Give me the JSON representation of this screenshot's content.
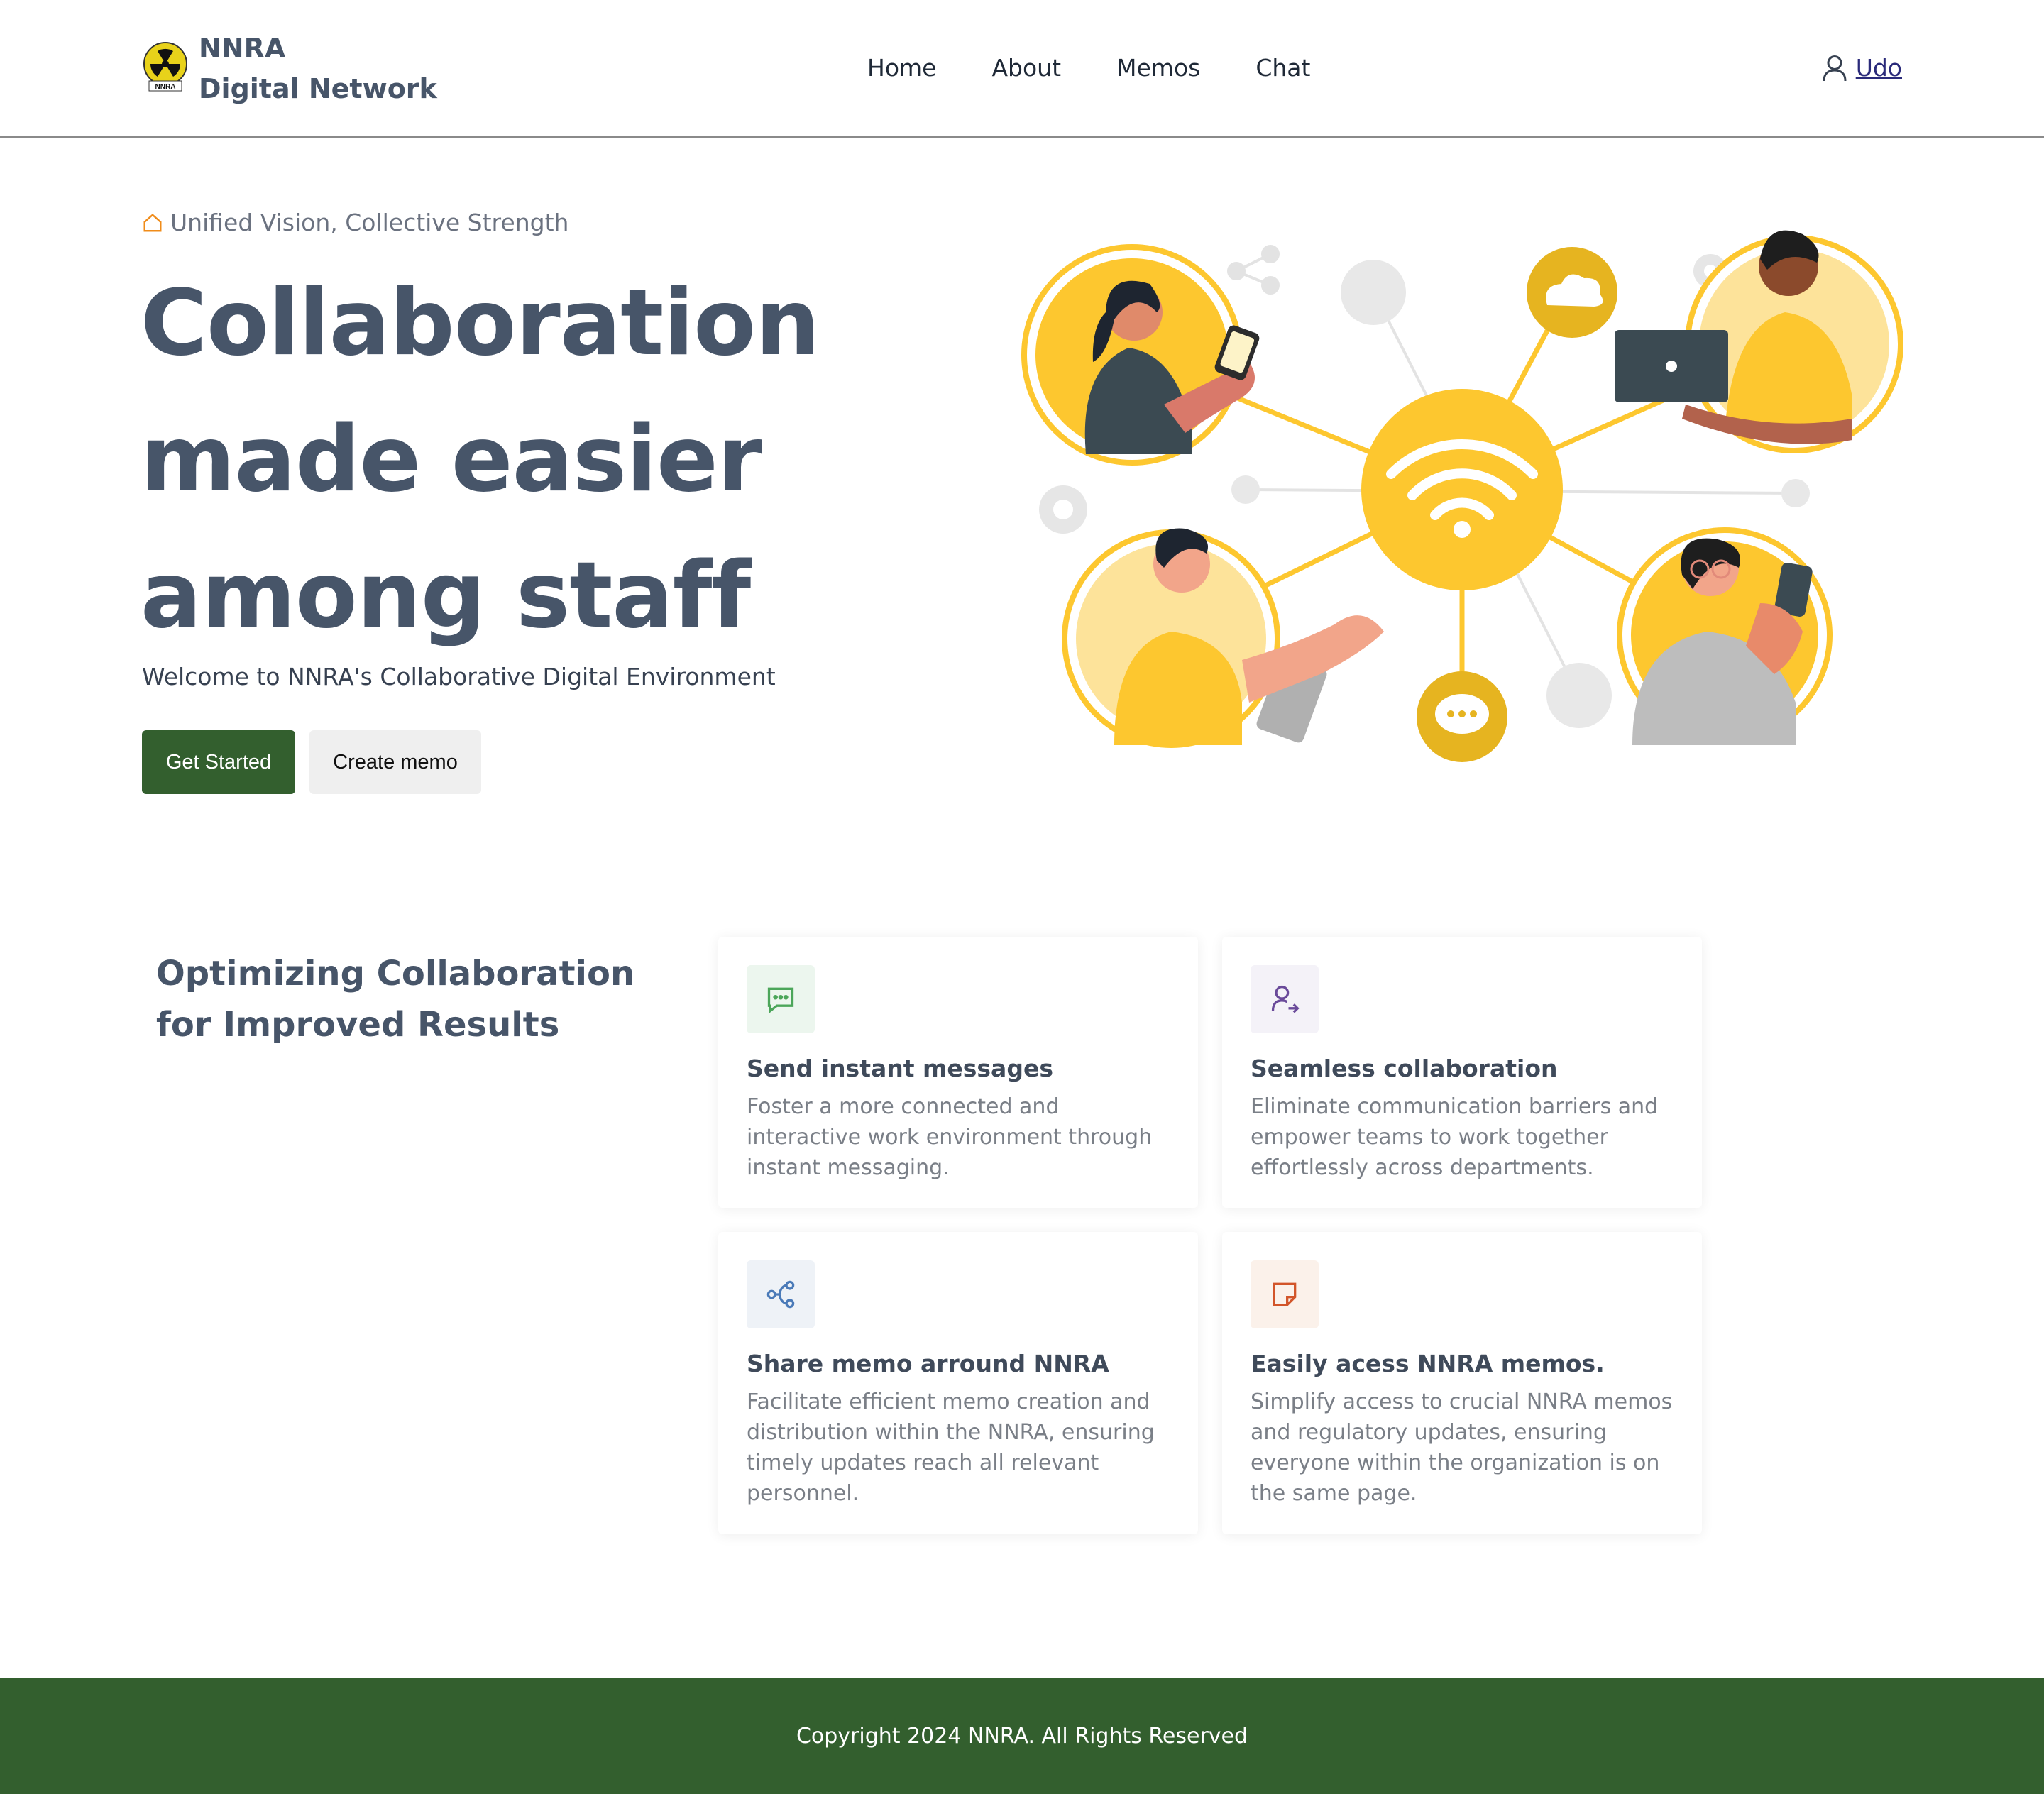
{
  "header": {
    "brand_line1": "NNRA",
    "brand_line2": "Digital Network",
    "logo_text": "NNRA",
    "nav": [
      "Home",
      "About",
      "Memos",
      "Chat"
    ],
    "user_name": "Udo"
  },
  "hero": {
    "tagline": "Unified Vision, Collective Strength",
    "title_line1": "Collaboration",
    "title_line2": "made easier",
    "title_line3": "among staff",
    "welcome": "Welcome to NNRA's Collaborative Digital Environment",
    "primary_button": "Get Started",
    "secondary_button": "Create memo"
  },
  "features": {
    "title_line1": "Optimizing Collaboration",
    "title_line2": "for Improved Results",
    "cards": [
      {
        "icon": "message-icon",
        "title": "Send instant messages",
        "text": "Foster a more connected and interactive work environment through instant messaging."
      },
      {
        "icon": "user-share-icon",
        "title": "Seamless collaboration",
        "text": "Eliminate communication barriers and empower teams to work together effortlessly across departments."
      },
      {
        "icon": "share-icon",
        "title": "Share memo arround NNRA",
        "text": "Facilitate efficient memo creation and distribution within the NNRA, ensuring timely updates reach all relevant personnel."
      },
      {
        "icon": "note-icon",
        "title": "Easily acess NNRA memos.",
        "text": "Simplify access to crucial NNRA memos and regulatory updates, ensuring everyone within the organization is on the same page."
      }
    ]
  },
  "footer": {
    "copyright": "Copyright 2024 NNRA. All Rights Reserved"
  },
  "colors": {
    "brand_green": "#335f2e",
    "accent_yellow": "#fdc72f",
    "text_slate": "#475569"
  }
}
